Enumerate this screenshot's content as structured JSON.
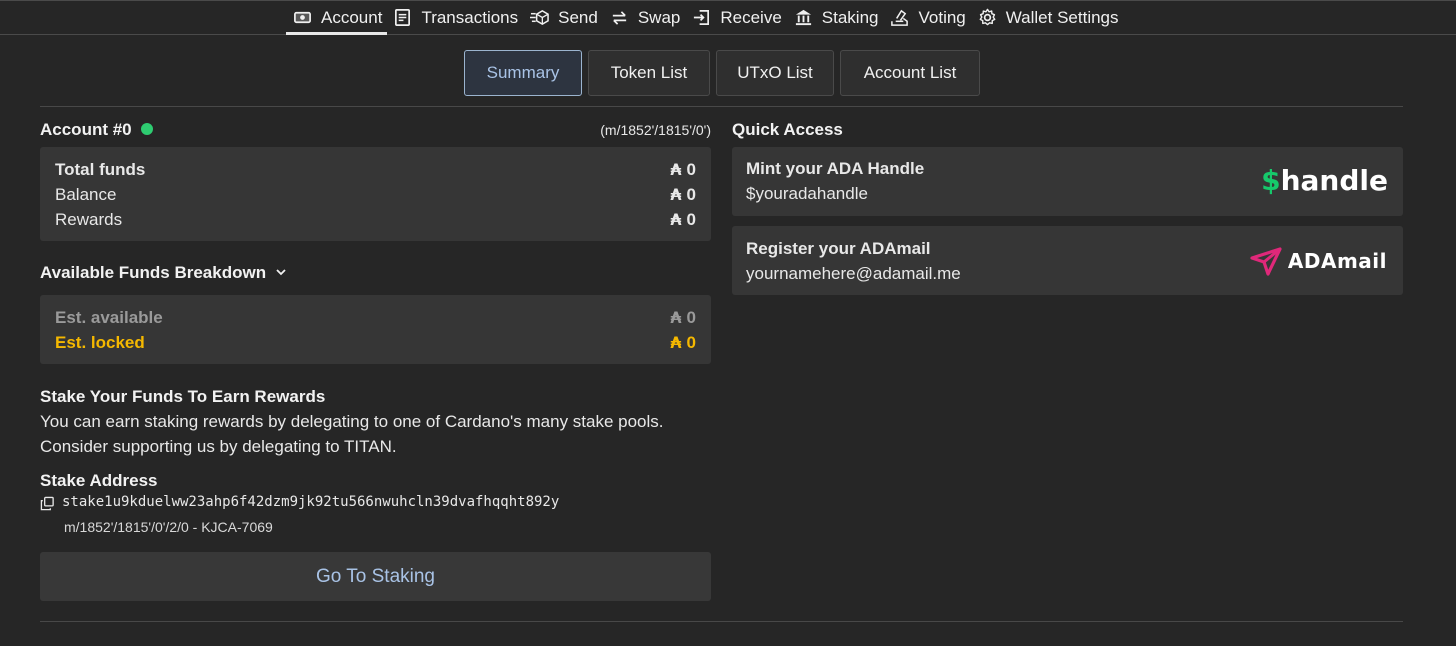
{
  "nav": [
    {
      "label": "Account",
      "icon": "account-icon",
      "active": true
    },
    {
      "label": "Transactions",
      "icon": "transactions-icon"
    },
    {
      "label": "Send",
      "icon": "send-icon"
    },
    {
      "label": "Swap",
      "icon": "swap-icon"
    },
    {
      "label": "Receive",
      "icon": "receive-icon"
    },
    {
      "label": "Staking",
      "icon": "staking-icon"
    },
    {
      "label": "Voting",
      "icon": "voting-icon"
    },
    {
      "label": "Wallet Settings",
      "icon": "gear-icon"
    }
  ],
  "tabs": [
    {
      "label": "Summary",
      "active": true
    },
    {
      "label": "Token List"
    },
    {
      "label": "UTxO List"
    },
    {
      "label": "Account List"
    }
  ],
  "account": {
    "title": "Account #0",
    "status_color": "#2ecc71",
    "path": "(m/1852'/1815'/0')"
  },
  "funds": {
    "currency_symbol": "₳",
    "total_label": "Total funds",
    "total_value": "0",
    "balance_label": "Balance",
    "balance_value": "0",
    "rewards_label": "Rewards",
    "rewards_value": "0"
  },
  "breakdown": {
    "title": "Available Funds Breakdown",
    "available_label": "Est. available",
    "available_value": "0",
    "locked_label": "Est. locked",
    "locked_value": "0",
    "locked_color": "#f5b800"
  },
  "stake": {
    "title": "Stake Your Funds To Earn Rewards",
    "line1": "You can earn staking rewards by delegating to one of Cardano's many stake pools.",
    "line2": "Consider supporting us by delegating to TITAN.",
    "address_title": "Stake Address",
    "address": "stake1u9kduelww23ahp6f42dzm9jk92tu566nwuhcln39dvafhqqht892y",
    "derivation": "m/1852'/1815'/0'/2/0 - KJCA-7069",
    "button_label": "Go To Staking"
  },
  "quick_access": {
    "title": "Quick Access",
    "handle": {
      "title": "Mint your ADA Handle",
      "subtitle": "$youradahandle",
      "logo_text": "handle",
      "logo_symbol": "$",
      "logo_color": "#16c96b"
    },
    "adamail": {
      "title": "Register your ADAmail",
      "subtitle": "yournamehere@adamail.me",
      "logo_text": "ADAmail",
      "logo_color": "#e0287a"
    }
  }
}
